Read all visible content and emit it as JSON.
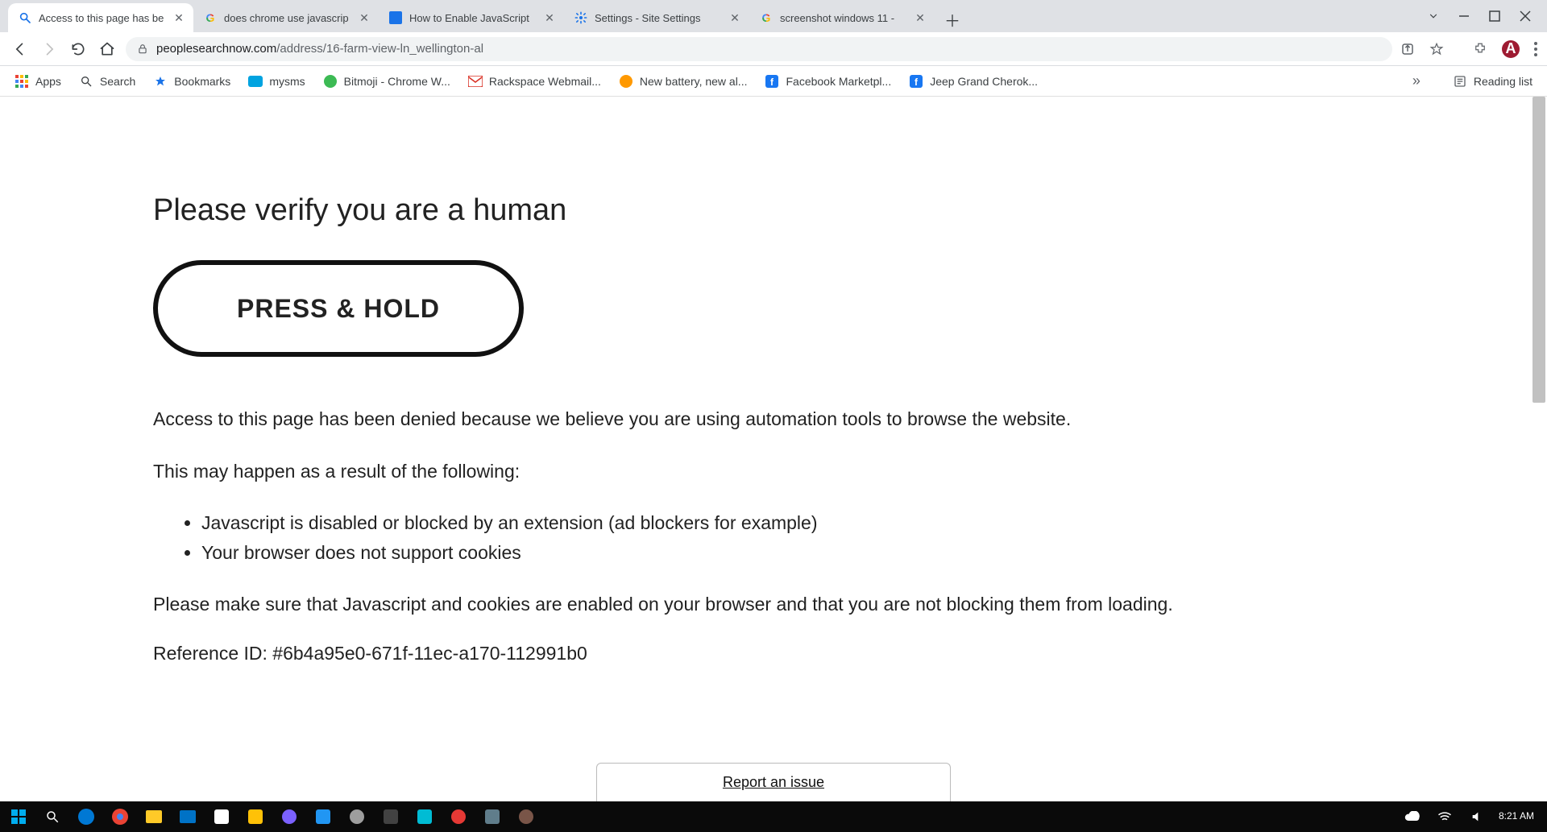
{
  "tabs": [
    {
      "title": "Access to this page has be",
      "icon": "magnifier"
    },
    {
      "title": "does chrome use javascrip",
      "icon": "google"
    },
    {
      "title": "How to Enable JavaScript",
      "icon": "blue-doc"
    },
    {
      "title": "Settings - Site Settings",
      "icon": "gear"
    },
    {
      "title": "screenshot windows 11 -",
      "icon": "google"
    }
  ],
  "address": {
    "host": "peoplesearchnow.com",
    "path": "/address/16-farm-view-ln_wellington-al"
  },
  "bookmarks": [
    {
      "label": "Apps",
      "icon": "apps"
    },
    {
      "label": "Search",
      "icon": "magnifier"
    },
    {
      "label": "Bookmarks",
      "icon": "star"
    },
    {
      "label": "mysms",
      "icon": "mysms"
    },
    {
      "label": "Bitmoji - Chrome W...",
      "icon": "bitmoji"
    },
    {
      "label": "Rackspace Webmail...",
      "icon": "mail"
    },
    {
      "label": "New battery, new al...",
      "icon": "amazon"
    },
    {
      "label": "Facebook Marketpl...",
      "icon": "facebook"
    },
    {
      "label": "Jeep Grand Cherok...",
      "icon": "facebook"
    }
  ],
  "reading_list_label": "Reading list",
  "page": {
    "heading": "Please verify you are a human",
    "button": "PRESS & HOLD",
    "denied": "Access to this page has been denied because we believe you are using automation tools to browse the website.",
    "reason_intro": "This may happen as a result of the following:",
    "reasons": [
      "Javascript is disabled or blocked by an extension (ad blockers for example)",
      "Your browser does not support cookies"
    ],
    "ensure": "Please make sure that Javascript and cookies are enabled on your browser and that you are not blocking them from loading.",
    "reference": "Reference ID: #6b4a95e0-671f-11ec-a170-112991b0",
    "report": "Report an issue"
  },
  "taskbar": {
    "time": "8:21 AM"
  }
}
